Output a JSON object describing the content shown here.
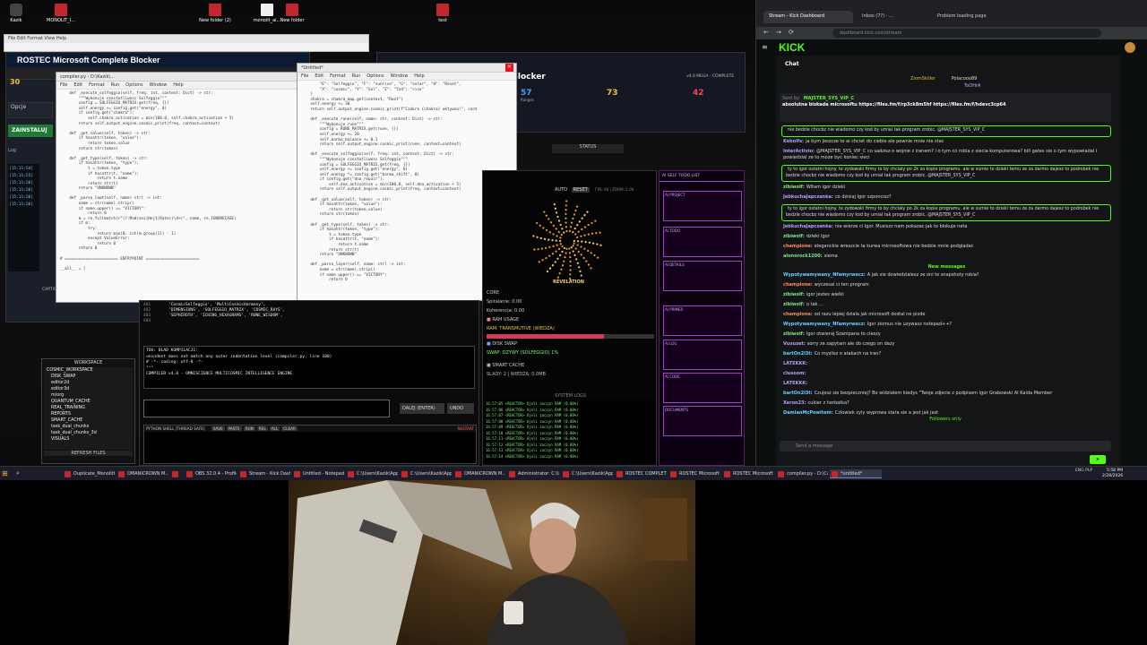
{
  "desktop": {
    "icons": [
      {
        "label": "Kazik",
        "type": "app"
      },
      {
        "label": "MONOLIT_I...",
        "type": "folder"
      },
      {
        "label": "New folder (2)",
        "type": "folder"
      },
      {
        "label": "monolit_ai...",
        "type": "doc"
      },
      {
        "label": "New folder",
        "type": "folder"
      },
      {
        "label": "test",
        "type": "folder"
      }
    ]
  },
  "rostec": {
    "title": "ROSTEC Microsoft Complete Blocker",
    "small_title_menu": "File  Edit  Format  View  Help",
    "count": "30",
    "opcje": "Opcje",
    "install_btn": "ZAINSTALUJ",
    "log_label": "Log",
    "log_lines": [
      "[15:11:54]",
      "[15:11:55]",
      "[15:11:56]",
      "[15:11:56]",
      "[15:11:56]",
      "[15:11:56]"
    ],
    "caption": "CAPTION",
    "workspace_title": "WORKSPACE",
    "workspace_items": [
      "COSMIC_WORKSPACE",
      "DISK_SWAP",
      "editor2d",
      "editor3d",
      "m/org",
      "QUANTUM_CACHE",
      "REAL_TRAINING",
      "REPORTS",
      "SMART_CACHE",
      "task_dual_chunks",
      "task_dual_chunks_3d",
      "VISUALS"
    ],
    "refresh_btn": "REFRESH FILES"
  },
  "dash": {
    "title": "Blocker",
    "version": "v4.0 MEGA - COMPLETE",
    "stats": [
      {
        "value": "57",
        "label": "Ranges",
        "color": "#3aa0ff"
      },
      {
        "value": "73",
        "label": "",
        "color": "#f0c040"
      },
      {
        "value": "42",
        "label": "",
        "color": "#ff4060"
      }
    ],
    "status": "STATUS"
  },
  "editor1": {
    "title": "compiler.py - D:\\Kazik\\...",
    "menu": [
      "File",
      "Edit",
      "Format",
      "Run",
      "Options",
      "Window",
      "Help"
    ],
    "code": "    def _execute_solfeggio(self, freq: int, context: Dict) -> str:\n        \"\"\"Wykonuje czestotliwosc Solfeggio\"\"\"\n        config = SOLFEGGIO_MATRIX.get(freq, {})\n        self.energy += config.get(\"energy\", 0)\n        if config.get(\"chakra\"):\n            self.chakra_activation = min(100.0, self.chakra_activation + 5)\n        return self.output_engine.cosmic_print(freq, context=context)\n\n    def _get_value(self, token) -> str:\n        if hasattr(token, \"value\"):\n            return token.value\n        return str(token)\n\n    def _get_type(self, token) -> str:\n        if hasattr(token, \"type\"):\n            t = token.type\n            if hasattr(t, \"name\"):\n                return t.name\n            return str(t)\n        return \"UNKNOWN\"\n\n    def _parse_lawt(self, name) str) -> int:\n        name = str(name).strip()\n        if name.upper() == \"VICTORY\":\n            return 0\n        m = re.fullmatch(r\"(?:Madrasz|Hejt|Rate)(\\d+)\", name, re.IGNORECASE)\n        if m:\n            try:\n                return max(0, int(m.group(1)) - 1)\n            except ValueError:\n                return 0\n        return 0\n\n# ======================= ENTRYPOINT =======================\n\n__all__ = ["
  },
  "editor2": {
    "title": "*Untitled*",
    "menu": [
      "File",
      "Edit",
      "Format",
      "Run",
      "Options",
      "Window",
      "Help"
    ],
    "code": "        \"E\": \"Solfeggio\", \"F\": \"sunrise\", \"G\": \"solar\", \"H\": \"Reset\",\n        \"X\": \"cosmic\", \"Y\": \"Sol\", \"Z\": \"Tzd\": \"rise\"\n    }\n    chakra = chakra_map.get(context, \"Root\")\n    self.energy += 30\n    return self.output_engine.cosmic_print(f\"Czakra {chakra} aktywna!\", cont\n\n    def _execute_rune(self, name: str, context: Dict) -> str:\n        \"\"\"Wykonuje rune\"\"\"\n        config = RUNE_MATRIX.get(rune, {})\n        self.energy += 20\n        self.karma_balance += 0.1\n        return self.output_engine.cosmic_print(rune, context=context)\n\n    def _execute_solfeggio(self, freq: int, context: Dict) -> str:\n        \"\"\"Wykonuje czestotliwosc Solfeggio\"\"\"\n        config = SOLFEGGIO_MATRIX.get(freq, {})\n        self.energy += config.get(\"energy\", 0)\n        self.energy *= config.get(\"karma_shift\", 0)\n        if config.get(\"dna_repair\"):\n            self.dna_activation = min(100.0, self.dna_activation + 5)\n        return self.output_engine.cosmic_print(freq, context=context)\n\n    def _get_value(self, token) -> str:\n        if hasattr(token, \"value\"):\n            return str(token.value)\n        return str(token)\n\n    def _get_type(self, token) -> str:\n        if hasattr(token, \"type\"):\n            t = token.type\n            if hasattr(t, \"name\"):\n                return t.name\n            return str(t)\n        return \"UNKNOWN\"\n\n    def _parse_layer(self, name: str) -> int:\n        name = str(name).strip()\n        if name.upper() == \"VICTORY\":\n            return 0",
    "status": "Ln: 66  Col: 0"
  },
  "terminal": {
    "code_lines": [
      "'CosmicSolfeggio', 'MultiCosmicHarmony',",
      "'DIMENSIONS', 'SOLFEGGIO_MATRIX', 'COSMIC_RAYS',",
      "'SEPHIROTH', 'ICHING_HEXAGRAMS', 'RUNE_WISDOM',"
    ],
    "line_numbers": [
      "481",
      "482",
      "483",
      "484"
    ],
    "error_lines": [
      "TOU: BLAD KOMPILACJI:",
      "unindent does not match any outer indentation level (compiler.py, line 100)",
      "",
      "# -*- coding: utf-8 -*-",
      "\"\"\"",
      "COMPILER v4.0 - OMNISCIENCE MULTICOSMIC INTELLIGENCE ENGINE"
    ],
    "next_btn": "DALEJ (ENTER)",
    "undo_btn": "UNDO",
    "shell_label": "PYTHON SHELL [THREAD SAFE]",
    "shell_tabs": [
      "SAVE",
      "PASTE",
      "RUN",
      "REL",
      "ALL",
      "CLEAR"
    ],
    "shell_status": "RESTART"
  },
  "viz": {
    "controls": [
      "AUTO",
      "RESET"
    ],
    "fps": "FPS: 60 | ZOOM: 1.00",
    "revelation": "REVELATION",
    "core": "CORE",
    "spiral": "Spiralanie: 0.00",
    "coherence": "Koherencja: 0.00",
    "ram_usage": "RAM USAGE",
    "ram_transmutive": "RAM: TRANSMUTIVE (WIEDZA)",
    "ram_level": 0.7,
    "disk_swap": "DISK SWAP",
    "swap_status": "SWAP: OZYWY (SOLFEGGIO) 1%",
    "smart_cache": "SMART CACHE",
    "cache_status": "SLADY: 2 | WIEDZA: 0.0MB",
    "system_logs": "SYSTEM LOGS",
    "log_lines": [
      "16:57:05 <REACTOR> Ujeli zaczyn RAM (0.00%)",
      "16:57:06 <REACTOR> Ujeli zaczyn RAM (0.00%)",
      "16:57:07 <REACTOR> Ujeli zaczyn RAM (0.00%)",
      "16:57:08 <REACTOR> Ujeli zaczyn RAM (0.00%)",
      "16:57:09 <REACTOR> Ujeli zaczyn RAM (0.00%)",
      "16:57:10 <REACTOR> Ujeli zaczyn RAM (0.00%)",
      "16:57:11 <REACTOR> Ujeli zaczyn RAM (0.00%)",
      "16:57:12 <REACTOR> Ujeli zaczyn RAM (0.00%)",
      "16:57:13 <REACTOR> Ujeli zaczyn RAM (0.00%)",
      "16:57:14 <REACTOR> Ujeli zaczyn RAM (0.00%)"
    ]
  },
  "viz2": {
    "title": "AI SELF TODO LIST",
    "sections": [
      "AI PROJECT",
      "AI TODO",
      "AI DETAILS",
      "AI PRIMER",
      "AI LOG",
      "AI CODE",
      "DOCUMENTS"
    ]
  },
  "browser": {
    "tabs": [
      "Stream - Kick Dashboard",
      "Inbox (7?) - ...",
      "Problem loading page"
    ],
    "url": "dashboard.kick.com/stream",
    "kick_logo": "KICK",
    "chat_title": "Chat",
    "top_users": [
      {
        "name": "ZiomSkiller",
        "count": "1"
      },
      {
        "name": "Polacooo89",
        "count": "1"
      },
      {
        "name": "ToOHrA",
        "count": "1"
      }
    ],
    "pinned_by": "Sent by",
    "pinned_user": "MAJSTER_SYS_VIP_C",
    "pinned_text": "absolutna biskada microsoftu https://files.fm/f/rp3ck8m5hf https://files.fm/f/hdevc3cp64",
    "messages": [
      {
        "user": "",
        "text": "nie bedzie chocbz nie wiadomo czy kod by umial tak program zrobic. @MAJSTER_SYS_VIP_C",
        "pinned": true
      },
      {
        "user": "Kebolfs:",
        "text": "ja bym jeszcze to ai chciat do ciebie ale pewnie mnie nie stac"
      },
      {
        "user": "InterActivio:",
        "text": "@MAJSTER_SYS_VIP_C co sadzisz o wojnie z iranem? i o tym co robia z siecia komputerowa? bill gates sie o tym wypowiadal i powiedzial ze to moze byc koniec sieci",
        "pinned": false
      },
      {
        "user": "",
        "text": "ty to igor ostatni hojny. te zydowski firmy to by chcialy po 2k za kopie programu. ale w sumie to dzieki temu ze za darmo dajesz to podrobek nie bedzie chocbz nie wiadomo czy kod by umial tak program zrobic. @MAJSTER_SYS_VIP_C",
        "pinned": true
      },
      {
        "user": "zibiwolf:",
        "text": "Witam igor dzieki"
      },
      {
        "user": "JebkuchaJapczanka:",
        "text": "co dzisiaj Igor szponcisz?"
      },
      {
        "user": "",
        "text": "ty to igor ostatni hojny. te zydowski firmy to by chcialy po 2k za kopie programu. ale w sumie to dzieki temu ze za darmo dajesz to podrobek nie bedzie chocbz nie wiadomo czy kod by umial tak program zrobic. @MAJSTER_SYS_VIP_C",
        "pinned": true
      },
      {
        "user": "JebkuchaJapczanka:",
        "text": "nie wierze ci Igor. Musiszz nam pokazac jak to blokuje neta"
      },
      {
        "user": "zibiwolf:",
        "text": "dzieki Igor"
      },
      {
        "user": "champione:",
        "text": "eleganckie wreszcie ta kurwa microsoftowa nie bedzie mnie podgladac"
      },
      {
        "user": "alonorock1200:",
        "text": "siema"
      }
    ],
    "new_messages": "New messages",
    "messages2": [
      {
        "user": "Wypotywamywany_Nfamyrwecz:",
        "text": "A jak sie dowiedzialesz ze oni te snapshoty robia?"
      },
      {
        "user": "champione:",
        "text": "wyczesal ci ten program"
      },
      {
        "user": "zibiwolf:",
        "text": "igor jestes wielki"
      },
      {
        "user": "zibiwolf:",
        "text": "o tak ..."
      },
      {
        "user": "champione:",
        "text": "od razu lepiej dziala jak microsoft dostal ne pizde"
      },
      {
        "user": "Wypotywamywany_Nfamyrwecz:",
        "text": "Igor ziomus nie uzywasz notepad++?"
      },
      {
        "user": "zibiwolf:",
        "text": "Igor otwieraj Szampana to cieszy"
      },
      {
        "user": "Vuvuzet:",
        "text": "sorry ze zapytam ale do czego on dazy"
      },
      {
        "user": "bartOn2l3t:",
        "text": "Co myslisz o atakach na iran?"
      },
      {
        "user": "LATEKKK:",
        "text": ""
      },
      {
        "user": "clusoom:",
        "text": ""
      },
      {
        "user": "LATEKKK:",
        "text": ""
      },
      {
        "user": "bartOn2l3t:",
        "text": "Czujesz sie bezpieczniej? Bo widzialem kiedys \"Twoje zdjecie z podpisem Igor Grabowski AI Kaida Member"
      },
      {
        "user": "Xeron23:",
        "text": "cukier z herbatka?"
      },
      {
        "user": "DamianMcPowitem:",
        "text": "Czlowiek zyly wyprowa stara sie a jest jak jest"
      }
    ],
    "followers": "Followers only",
    "send_placeholder": "Send a message"
  },
  "taskbar": {
    "items": [
      "Duplicate_Monolith...",
      "OMANICROWN M...",
      "",
      "OBS 32.0.4 - Profile...",
      "Stream - Kick Dash...",
      "Untitled - Notepad",
      "C:\\Users\\Kazik\\App...",
      "C:\\Users\\Kazik\\App...",
      "OMANICROWN M...",
      "Administrator: C:\\U...",
      "C:\\Users\\Kazik\\App...",
      "ROSTEC COMPLETE...",
      "ROSTEC Microsoft ...",
      "ROSTEC Microsoft ...",
      "compiler.py - D:\\Ca...",
      "*untitled*"
    ],
    "lang": "ENG PLP",
    "time": "5:58 PM",
    "date": "2/28/2026"
  },
  "colors": {
    "kick_green": "#53fc18",
    "accent_purple": "#a23fc6",
    "error_red": "#ff4060"
  }
}
